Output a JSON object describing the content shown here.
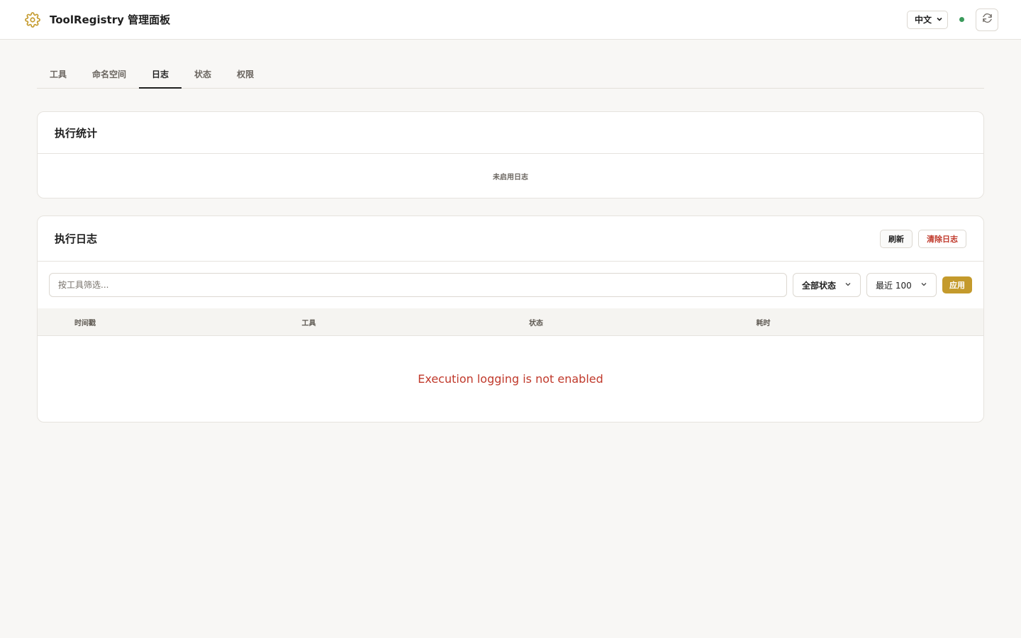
{
  "header": {
    "title": "ToolRegistry 管理面板",
    "language": "中文",
    "colors": {
      "accent": "#c49a2c",
      "status_ok": "#3a9a5b",
      "danger": "#c0392b"
    }
  },
  "tabs": [
    {
      "label": "工具",
      "active": false
    },
    {
      "label": "命名空间",
      "active": false
    },
    {
      "label": "日志",
      "active": true
    },
    {
      "label": "状态",
      "active": false
    },
    {
      "label": "权限",
      "active": false
    }
  ],
  "stats_card": {
    "title": "执行统计",
    "empty_text": "未启用日志"
  },
  "log_card": {
    "title": "执行日志",
    "refresh_label": "刷新",
    "clear_label": "清除日志",
    "filter_placeholder": "按工具筛选...",
    "status_select": "全部状态",
    "limit_select": "最近 100",
    "apply_label": "应用",
    "columns": [
      "时间戳",
      "工具",
      "状态",
      "耗时"
    ],
    "message": "Execution logging is not enabled"
  }
}
